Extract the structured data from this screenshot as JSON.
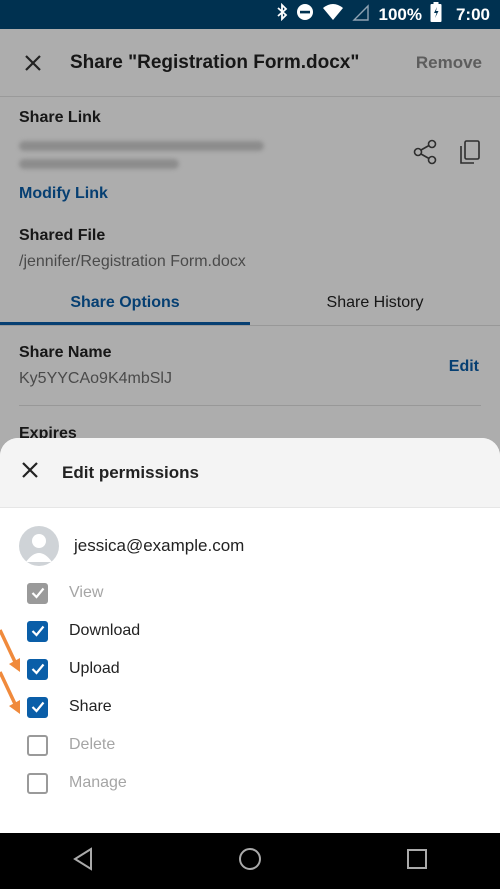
{
  "status_bar": {
    "battery": "100%",
    "time": "7:00"
  },
  "app": {
    "title": "Share \"Registration Form.docx\"",
    "remove_label": "Remove",
    "share_link_label": "Share Link",
    "modify_link_label": "Modify Link",
    "shared_file_label": "Shared File",
    "shared_file_path": "/jennifer/Registration Form.docx",
    "tabs": [
      {
        "label": "Share Options",
        "active": true
      },
      {
        "label": "Share History",
        "active": false
      }
    ],
    "share_name_label": "Share Name",
    "share_name_value": "Ky5YYCAo9K4mbSlJ",
    "edit_label": "Edit",
    "expires_label": "Expires"
  },
  "sheet": {
    "title": "Edit permissions",
    "user_email": "jessica@example.com",
    "permissions": [
      {
        "label": "View",
        "checked": true,
        "disabled": true
      },
      {
        "label": "Download",
        "checked": true,
        "disabled": false
      },
      {
        "label": "Upload",
        "checked": true,
        "disabled": false
      },
      {
        "label": "Share",
        "checked": true,
        "disabled": false
      },
      {
        "label": "Delete",
        "checked": false,
        "disabled": true
      },
      {
        "label": "Manage",
        "checked": false,
        "disabled": true
      }
    ]
  },
  "colors": {
    "accent": "#0a5ea8",
    "status_bar": "#003150",
    "annotation_arrow": "#f08a3c"
  },
  "icons": [
    "bluetooth-icon",
    "dnd-icon",
    "wifi-icon",
    "signal-icon",
    "battery-icon",
    "close-icon",
    "share-icon",
    "copy-icon",
    "avatar-icon",
    "back-icon",
    "home-icon",
    "recents-icon",
    "annotation-arrow-icon"
  ]
}
